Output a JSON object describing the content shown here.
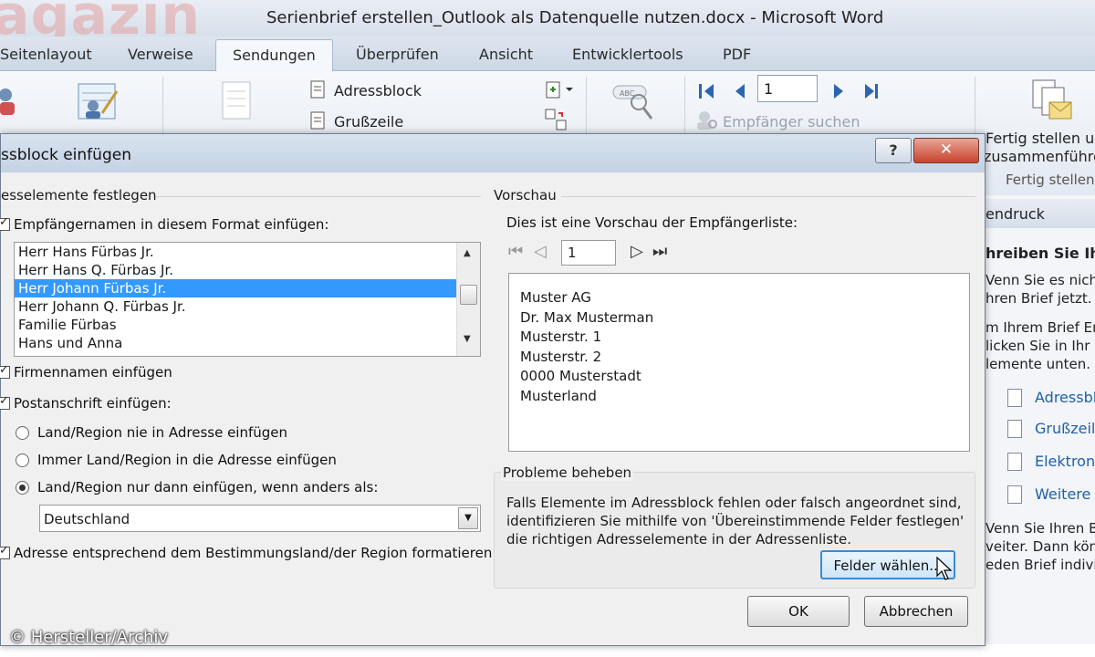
{
  "window": {
    "watermark_logo": "Magazin",
    "title": "Serienbrief erstellen_Outlook als Datenquelle nutzen.docx  -  Microsoft Word"
  },
  "tabs": [
    {
      "label": "Seitenlayout"
    },
    {
      "label": "Verweise"
    },
    {
      "label": "Sendungen",
      "active": true
    },
    {
      "label": "Überprüfen"
    },
    {
      "label": "Ansicht"
    },
    {
      "label": "Entwicklertools"
    },
    {
      "label": "PDF"
    }
  ],
  "ribbon": {
    "adressblock": "Adressblock",
    "grusszeile": "Grußzeile",
    "record_number": "1",
    "empfaenger_suchen": "Empfänger suchen",
    "fertig_label_1": "Fertig stellen u",
    "fertig_label_2": "zusammenführe",
    "fertig_group": "Fertig stellen"
  },
  "task_pane": {
    "header": "endruck",
    "heading": "hreiben Sie Ih",
    "lines_a": [
      "Venn Sie es nich",
      "hren Brief jetzt."
    ],
    "lines_b": [
      "m Ihrem Brief En",
      "licken Sie in Ihr D",
      "lemente unten."
    ],
    "links": [
      "Adressbl",
      "Grußzeile",
      "Elektronis",
      "Weitere E"
    ],
    "lines_c": [
      "Venn Sie Ihren B",
      "veiter. Dann kön",
      "eden Brief indivic"
    ]
  },
  "dialog": {
    "title": "ssblock einfügen",
    "help": "?",
    "close": "✕",
    "left_group": "esselemente festlegen",
    "recipient_names_label": "Empfängernamen in diesem Format einfügen:",
    "name_formats": [
      "Herr Hans Fürbas Jr.",
      "Herr Hans Q. Fürbas Jr.",
      "Herr Johann Fürbas Jr.",
      "Herr Johann Q. Fürbas Jr.",
      "Familie Fürbas",
      "Hans und Anna"
    ],
    "selected_format": "Herr Johann Fürbas Jr.",
    "company_label": "Firmennamen einfügen",
    "postal_label": "Postanschrift einfügen:",
    "radio_never": "Land/Region nie in Adresse einfügen",
    "radio_always": "Immer Land/Region in die Adresse einfügen",
    "radio_only_if": "Land/Region nur dann einfügen, wenn anders als:",
    "country_value": "Deutschland",
    "format_dest_label": "Adresse entsprechend dem Bestimmungsland/der Region formatieren",
    "preview_group": "Vorschau",
    "preview_intro": "Dies ist eine Vorschau der Empfängerliste:",
    "preview_record": "1",
    "preview_lines": [
      "Muster AG",
      "Dr. Max Musterman",
      "Musterstr. 1",
      "Musterstr. 2",
      "0000 Musterstadt",
      "Musterland"
    ],
    "trouble_group": "Probleme beheben",
    "trouble_text": "Falls Elemente im Adressblock fehlen oder falsch angeordnet sind, identifizieren Sie mithilfe von 'Übereinstimmende Felder festlegen' die richtigen Adresselemente in der Adressenliste.",
    "match_fields_button": "Felder wählen...",
    "ok_button": "OK",
    "cancel_button": "Abbrechen"
  },
  "credit": "© Hersteller/Archiv"
}
